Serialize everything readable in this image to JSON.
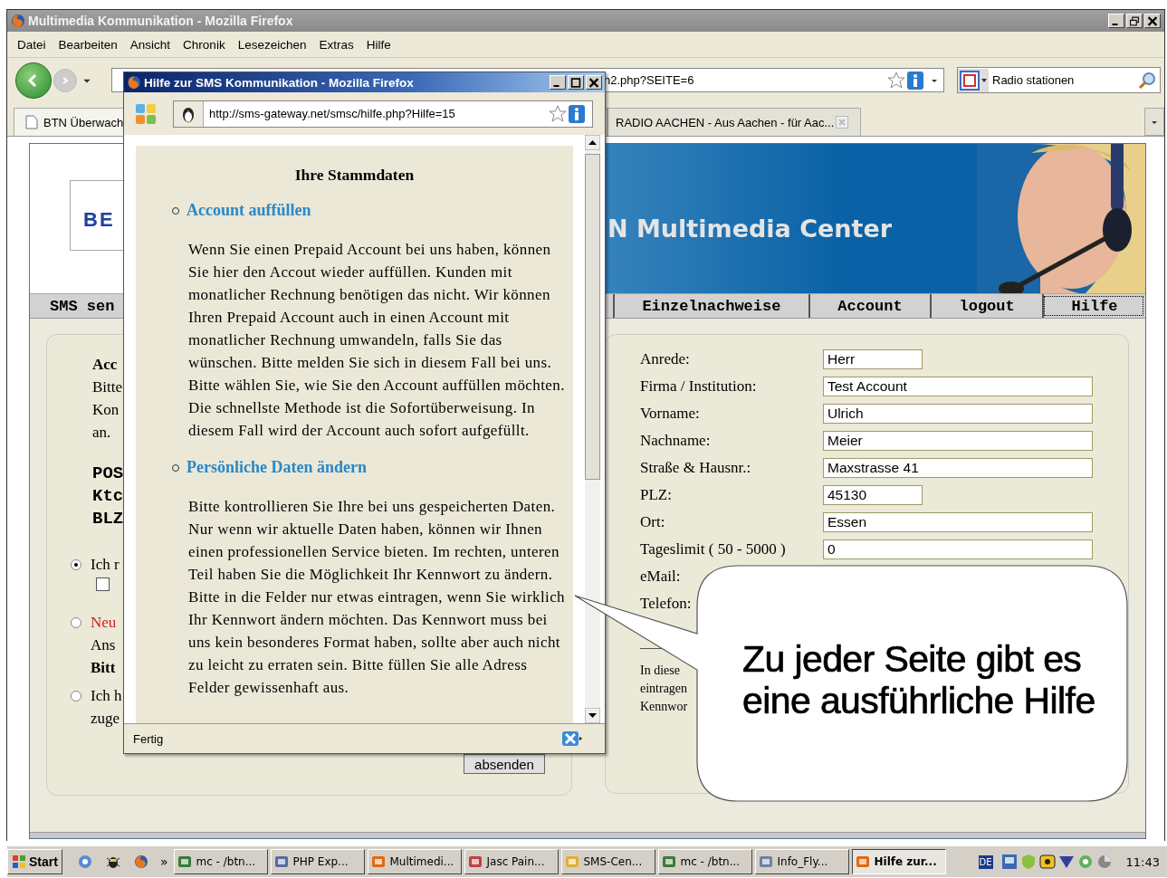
{
  "window": {
    "title": "Multimedia Kommunikation - Mozilla Firefox"
  },
  "menu": [
    "Datei",
    "Bearbeiten",
    "Ansicht",
    "Chronik",
    "Lesezeichen",
    "Extras",
    "Hilfe"
  ],
  "toolbar": {
    "url": "h2.php?SEITE=6",
    "search": "Radio stationen"
  },
  "tabs": [
    {
      "label": "BTN Überwach"
    },
    {
      "label": "RADIO AACHEN - Aus Aachen - für Aac..."
    }
  ],
  "page": {
    "logo": "BE",
    "banner": "N Multimedia Center",
    "nav": [
      {
        "label": "SMS sen",
        "selected": false
      },
      {
        "label": "Einzelnachweise",
        "selected": false
      },
      {
        "label": "Account",
        "selected": false
      },
      {
        "label": "logout",
        "selected": false
      },
      {
        "label": "Hilfe",
        "selected": true
      }
    ],
    "intro": [
      {
        "text": "Acc",
        "kind": "bold"
      },
      {
        "text": "Bitte",
        "kind": "plain"
      },
      {
        "text": "Kon",
        "kind": "plain"
      },
      {
        "text": "an.",
        "kind": "plain"
      }
    ],
    "bank": [
      "POS",
      "Ktc",
      "BLZ"
    ],
    "options": [
      {
        "selected": true,
        "lines": [
          {
            "text": "Ich r",
            "kind": "plain"
          }
        ],
        "checkbox": {
          "checked": false
        }
      },
      {
        "selected": false,
        "lines": [
          {
            "text": "Neu",
            "kind": "alert"
          },
          {
            "text": "Ans",
            "kind": "plain"
          },
          {
            "text": "Bitt",
            "kind": "bold"
          }
        ]
      },
      {
        "selected": false,
        "lines": [
          {
            "text": "Ich h",
            "kind": "plain"
          },
          {
            "text": "zuge",
            "kind": "plain"
          }
        ]
      }
    ],
    "submit": "absenden",
    "form": [
      {
        "label": "Anrede:",
        "value": "Herr",
        "kind": "short"
      },
      {
        "label": "Firma / Institution:",
        "value": "Test Account",
        "kind": "long"
      },
      {
        "label": "Vorname:",
        "value": "Ulrich",
        "kind": "long"
      },
      {
        "label": "Nachname:",
        "value": "Meier",
        "kind": "long"
      },
      {
        "label": "Straße & Hausnr.:",
        "value": "Maxstrasse 41",
        "kind": "long"
      },
      {
        "label": "PLZ:",
        "value": "45130",
        "kind": "short"
      },
      {
        "label": "Ort:",
        "value": "Essen",
        "kind": "long"
      },
      {
        "label": "Tageslimit ( 50 - 5000 )",
        "value": "0",
        "kind": "long"
      },
      {
        "label": "eMail:",
        "kind": "label"
      },
      {
        "label": "Telefon:",
        "kind": "label"
      }
    ],
    "note": [
      "In diese",
      "eintragen",
      "Kennwor"
    ]
  },
  "popup": {
    "title": "Hilfe zur SMS Kommunikation - Mozilla Firefox",
    "url": "http://sms-gateway.net/smsc/hilfe.php?Hilfe=15",
    "heading": "Ihre Stammdaten",
    "sections": [
      {
        "title": "Account auffüllen",
        "text": "Wenn Sie einen Prepaid Account bei uns haben, können Sie hier den Accout wieder auffüllen. Kunden mit monatlicher Rechnung benötigen das nicht. Wir können Ihren Prepaid Account auch in einen Account mit monatlicher Rechnung umwandeln, falls Sie das wünschen. Bitte melden Sie sich in diesem Fall bei uns. Bitte wählen Sie, wie Sie den Account auffüllen möchten. Die schnellste Methode ist die Sofortüberweisung. In diesem Fall wird der Account auch sofort aufgefüllt."
      },
      {
        "title": "Persönliche Daten ändern",
        "text": "Bitte kontrollieren Sie Ihre bei uns gespeicherten Daten. Nur wenn wir aktuelle Daten haben, können wir Ihnen einen professionellen Service bieten. Im rechten, unteren Teil haben Sie die Möglichkeit Ihr Kennwort zu ändern. Bitte in die Felder nur etwas eintragen, wenn Sie wirklich Ihr Kennwort ändern möchten. Das Kennwort muss bei uns kein besonderes Format haben, sollte aber auch nicht zu leicht zu erraten sein. Bitte füllen Sie alle Adress Felder gewissenhaft aus."
      }
    ],
    "status": "Fertig"
  },
  "callout": {
    "text": "Zu jeder Seite gibt es eine ausführliche Hilfe"
  },
  "taskbar": {
    "start": "Start",
    "more": "»",
    "tasks": [
      {
        "label": "mc - /btn...",
        "selected": false
      },
      {
        "label": "PHP Exp...",
        "selected": false
      },
      {
        "label": "Multimedi...",
        "selected": false
      },
      {
        "label": "Jasc Pain...",
        "selected": false
      },
      {
        "label": "SMS-Cen...",
        "selected": false
      },
      {
        "label": "mc - /btn...",
        "selected": false
      },
      {
        "label": "Info_Fly...",
        "selected": false
      },
      {
        "label": "Hilfe zur...",
        "selected": true
      }
    ],
    "language": "DE",
    "clock": "11:43"
  }
}
